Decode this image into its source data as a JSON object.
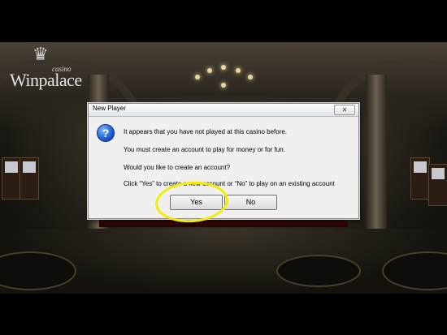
{
  "logo": {
    "crown_glyph": "♛",
    "casino_label": "casino",
    "name": "Winpalace"
  },
  "dialog": {
    "title": "New Player",
    "close_glyph": "✕",
    "icon": "question-icon",
    "icon_glyph": "?",
    "messages": [
      "It appears that you have not played at this casino before.",
      "You must create an account to play for money or for fun.",
      "Would you like to create an account?",
      "Click “Yes” to create a new account or “No” to play on an existing account"
    ],
    "yes_label": "Yes",
    "no_label": "No"
  },
  "colors": {
    "highlight": "#f2ee00",
    "dialog_bg": "#f0f0f0",
    "question_icon": "#1c5bd6"
  }
}
